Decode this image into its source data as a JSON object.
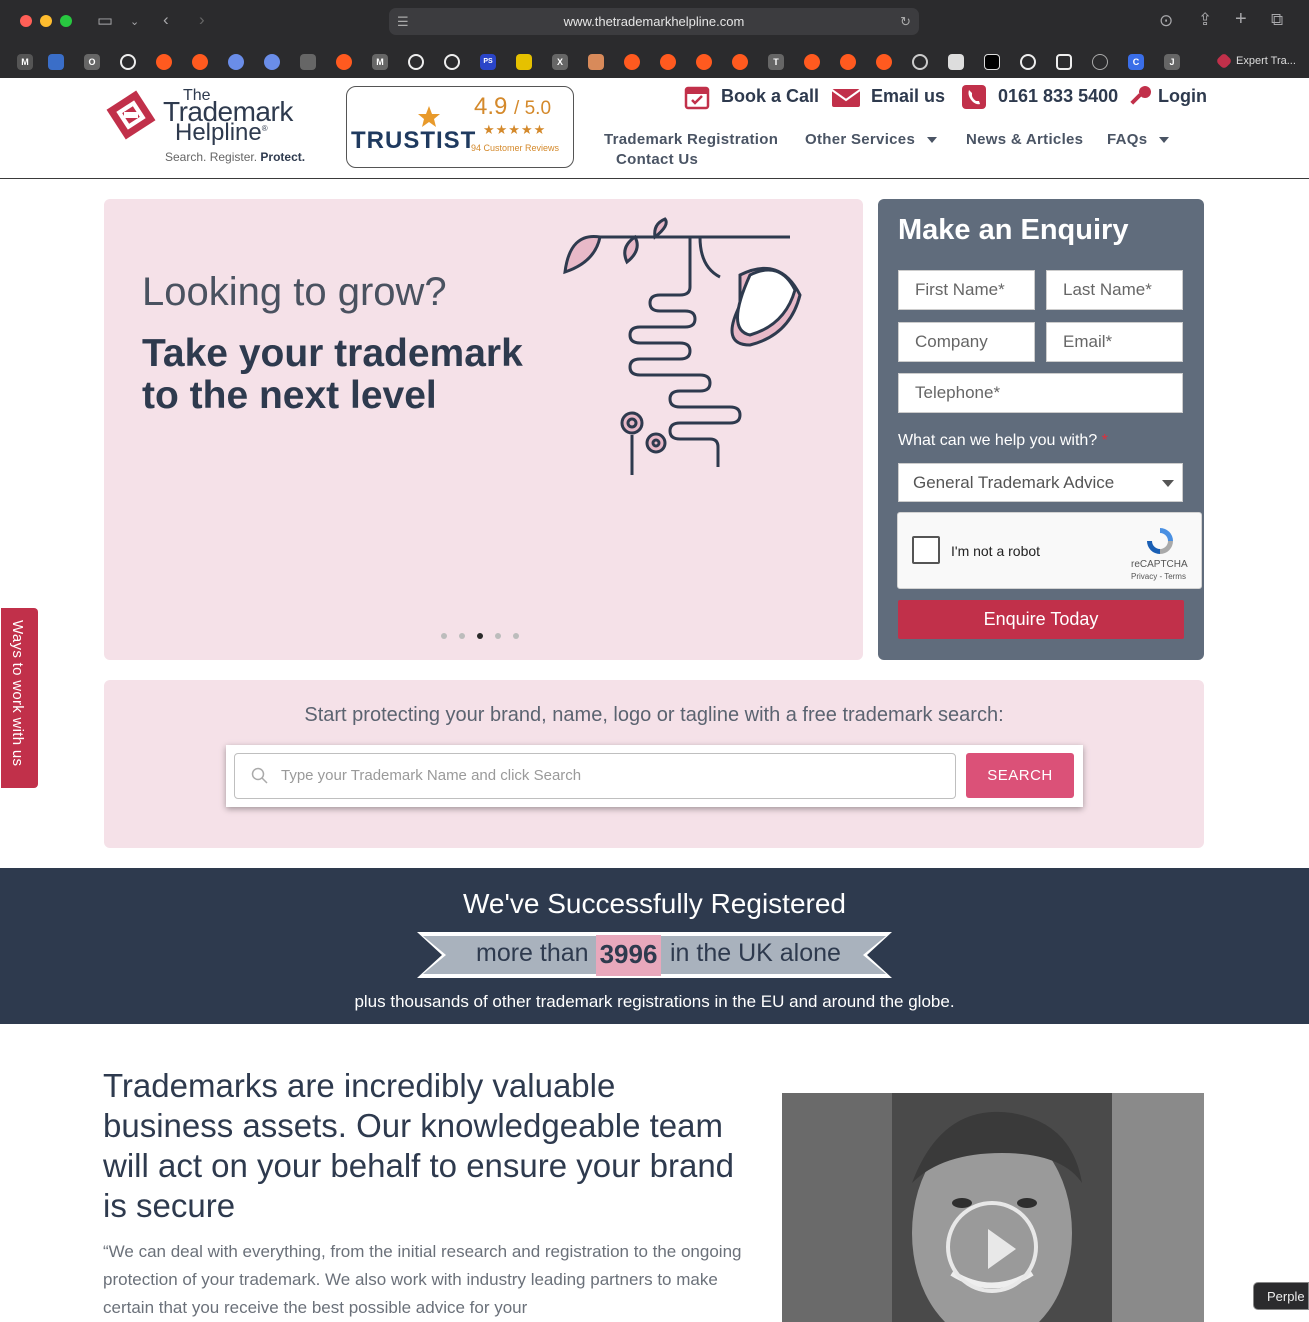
{
  "browser": {
    "url": "www.thetrademarkhelpline.com",
    "tab_title": "Expert Tra...",
    "favicons": [
      "M",
      "O",
      "M",
      "X",
      "PS",
      "X",
      "T",
      "C",
      "J"
    ]
  },
  "logo": {
    "the": "The",
    "trademark": "Trademark",
    "helpline": "Helpline",
    "reg": "®",
    "tag_search": "Search.",
    "tag_register": "Register.",
    "tag_protect": "Protect."
  },
  "trustist": {
    "brand": "TRUSTIST",
    "score": "4.9",
    "out_of": "/ 5.0",
    "stars": "★★★★★",
    "reviews": "94 Customer Reviews"
  },
  "top_links": {
    "book": "Book a Call",
    "email": "Email us",
    "phone": "0161 833 5400",
    "login": "Login"
  },
  "nav": {
    "registration": "Trademark Registration",
    "other": "Other Services",
    "news": "News & Articles",
    "faqs": "FAQs",
    "contact": "Contact Us"
  },
  "hero": {
    "line1": "Looking to grow?",
    "line2": "Take your trademark to the next level",
    "slides": 5,
    "active_slide": 3
  },
  "enquiry": {
    "title": "Make an Enquiry",
    "first": "First Name*",
    "last": "Last Name*",
    "company": "Company",
    "email": "Email*",
    "phone": "Telephone*",
    "help_label": "What can we help you with?",
    "required": "*",
    "help_value": "General Trademark Advice",
    "captcha_text": "I'm not a robot",
    "captcha_brand": "reCAPTCHA",
    "captcha_links": "Privacy - Terms",
    "submit": "Enquire Today"
  },
  "side_tab": "Ways to work with us",
  "search": {
    "title": "Start protecting your brand, name, logo or tagline with a free trademark search:",
    "placeholder": "Type your Trademark Name and click Search",
    "button": "SEARCH"
  },
  "stats": {
    "heading": "We've Successfully Registered",
    "before": "more than",
    "count": "3996",
    "after": "in the UK alone",
    "sub": "plus thousands of other trademark registrations in the EU and around the globe."
  },
  "body": {
    "heading": "Trademarks are incredibly valuable business assets. Our knowledgeable team will act on your behalf to ensure your brand is secure",
    "paragraph": "“We can deal with everything, from the initial research and registration to the ongoing protection of your trademark. We also work with industry leading partners to make certain that you receive the best possible advice for your"
  },
  "overlay": "Perple",
  "colors": {
    "brand_red": "#c1304a",
    "navy": "#2e3a4e",
    "pink_bg": "#f5e1e8",
    "slate": "#606c7c",
    "search_btn": "#db5178"
  }
}
